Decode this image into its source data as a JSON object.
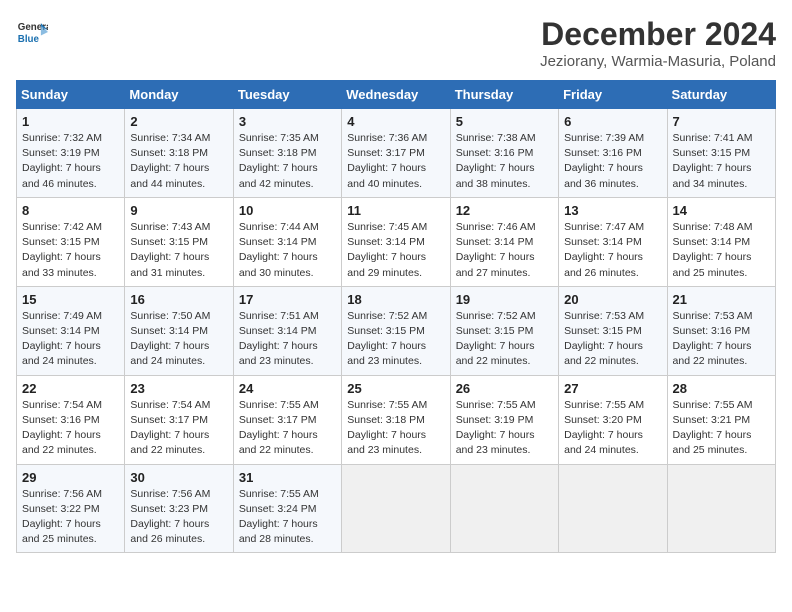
{
  "logo": {
    "line1": "General",
    "line2": "Blue"
  },
  "title": "December 2024",
  "subtitle": "Jeziorany, Warmia-Masuria, Poland",
  "days_of_week": [
    "Sunday",
    "Monday",
    "Tuesday",
    "Wednesday",
    "Thursday",
    "Friday",
    "Saturday"
  ],
  "weeks": [
    [
      {
        "day": "1",
        "info": "Sunrise: 7:32 AM\nSunset: 3:19 PM\nDaylight: 7 hours\nand 46 minutes."
      },
      {
        "day": "2",
        "info": "Sunrise: 7:34 AM\nSunset: 3:18 PM\nDaylight: 7 hours\nand 44 minutes."
      },
      {
        "day": "3",
        "info": "Sunrise: 7:35 AM\nSunset: 3:18 PM\nDaylight: 7 hours\nand 42 minutes."
      },
      {
        "day": "4",
        "info": "Sunrise: 7:36 AM\nSunset: 3:17 PM\nDaylight: 7 hours\nand 40 minutes."
      },
      {
        "day": "5",
        "info": "Sunrise: 7:38 AM\nSunset: 3:16 PM\nDaylight: 7 hours\nand 38 minutes."
      },
      {
        "day": "6",
        "info": "Sunrise: 7:39 AM\nSunset: 3:16 PM\nDaylight: 7 hours\nand 36 minutes."
      },
      {
        "day": "7",
        "info": "Sunrise: 7:41 AM\nSunset: 3:15 PM\nDaylight: 7 hours\nand 34 minutes."
      }
    ],
    [
      {
        "day": "8",
        "info": "Sunrise: 7:42 AM\nSunset: 3:15 PM\nDaylight: 7 hours\nand 33 minutes."
      },
      {
        "day": "9",
        "info": "Sunrise: 7:43 AM\nSunset: 3:15 PM\nDaylight: 7 hours\nand 31 minutes."
      },
      {
        "day": "10",
        "info": "Sunrise: 7:44 AM\nSunset: 3:14 PM\nDaylight: 7 hours\nand 30 minutes."
      },
      {
        "day": "11",
        "info": "Sunrise: 7:45 AM\nSunset: 3:14 PM\nDaylight: 7 hours\nand 29 minutes."
      },
      {
        "day": "12",
        "info": "Sunrise: 7:46 AM\nSunset: 3:14 PM\nDaylight: 7 hours\nand 27 minutes."
      },
      {
        "day": "13",
        "info": "Sunrise: 7:47 AM\nSunset: 3:14 PM\nDaylight: 7 hours\nand 26 minutes."
      },
      {
        "day": "14",
        "info": "Sunrise: 7:48 AM\nSunset: 3:14 PM\nDaylight: 7 hours\nand 25 minutes."
      }
    ],
    [
      {
        "day": "15",
        "info": "Sunrise: 7:49 AM\nSunset: 3:14 PM\nDaylight: 7 hours\nand 24 minutes."
      },
      {
        "day": "16",
        "info": "Sunrise: 7:50 AM\nSunset: 3:14 PM\nDaylight: 7 hours\nand 24 minutes."
      },
      {
        "day": "17",
        "info": "Sunrise: 7:51 AM\nSunset: 3:14 PM\nDaylight: 7 hours\nand 23 minutes."
      },
      {
        "day": "18",
        "info": "Sunrise: 7:52 AM\nSunset: 3:15 PM\nDaylight: 7 hours\nand 23 minutes."
      },
      {
        "day": "19",
        "info": "Sunrise: 7:52 AM\nSunset: 3:15 PM\nDaylight: 7 hours\nand 22 minutes."
      },
      {
        "day": "20",
        "info": "Sunrise: 7:53 AM\nSunset: 3:15 PM\nDaylight: 7 hours\nand 22 minutes."
      },
      {
        "day": "21",
        "info": "Sunrise: 7:53 AM\nSunset: 3:16 PM\nDaylight: 7 hours\nand 22 minutes."
      }
    ],
    [
      {
        "day": "22",
        "info": "Sunrise: 7:54 AM\nSunset: 3:16 PM\nDaylight: 7 hours\nand 22 minutes."
      },
      {
        "day": "23",
        "info": "Sunrise: 7:54 AM\nSunset: 3:17 PM\nDaylight: 7 hours\nand 22 minutes."
      },
      {
        "day": "24",
        "info": "Sunrise: 7:55 AM\nSunset: 3:17 PM\nDaylight: 7 hours\nand 22 minutes."
      },
      {
        "day": "25",
        "info": "Sunrise: 7:55 AM\nSunset: 3:18 PM\nDaylight: 7 hours\nand 23 minutes."
      },
      {
        "day": "26",
        "info": "Sunrise: 7:55 AM\nSunset: 3:19 PM\nDaylight: 7 hours\nand 23 minutes."
      },
      {
        "day": "27",
        "info": "Sunrise: 7:55 AM\nSunset: 3:20 PM\nDaylight: 7 hours\nand 24 minutes."
      },
      {
        "day": "28",
        "info": "Sunrise: 7:55 AM\nSunset: 3:21 PM\nDaylight: 7 hours\nand 25 minutes."
      }
    ],
    [
      {
        "day": "29",
        "info": "Sunrise: 7:56 AM\nSunset: 3:22 PM\nDaylight: 7 hours\nand 25 minutes."
      },
      {
        "day": "30",
        "info": "Sunrise: 7:56 AM\nSunset: 3:23 PM\nDaylight: 7 hours\nand 26 minutes."
      },
      {
        "day": "31",
        "info": "Sunrise: 7:55 AM\nSunset: 3:24 PM\nDaylight: 7 hours\nand 28 minutes."
      },
      {
        "day": "",
        "info": ""
      },
      {
        "day": "",
        "info": ""
      },
      {
        "day": "",
        "info": ""
      },
      {
        "day": "",
        "info": ""
      }
    ]
  ]
}
